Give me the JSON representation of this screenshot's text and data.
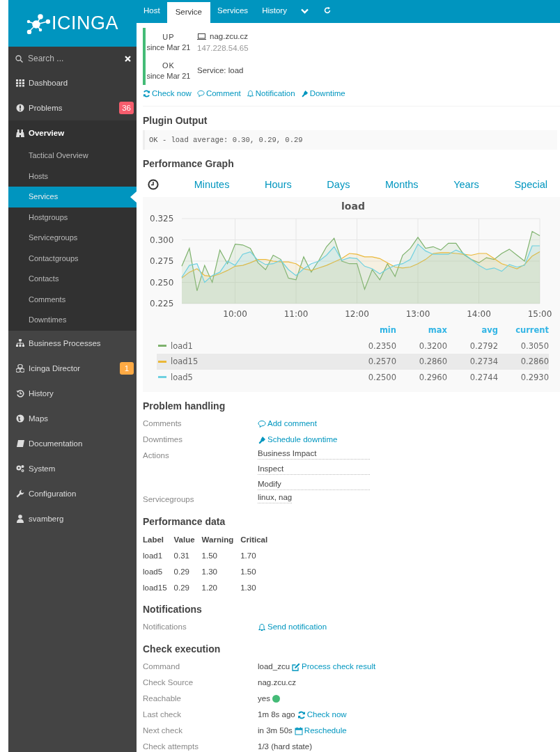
{
  "sidebar": {
    "logo": "ICINGA",
    "search": {
      "placeholder": "Search ..."
    },
    "items": [
      {
        "label": "Dashboard",
        "selected": false,
        "expanded": false
      },
      {
        "label": "Problems",
        "selected": false,
        "expanded": false,
        "badge": "36",
        "color": "#f65d6d"
      },
      {
        "label": "Overview",
        "selected": false,
        "expanded": true,
        "children": [
          {
            "label": "Tactical Overview",
            "selected": false
          },
          {
            "label": "Hosts",
            "selected": false
          },
          {
            "label": "Services",
            "selected": true
          },
          {
            "label": "Hostgroups",
            "selected": false
          },
          {
            "label": "Servicegroups",
            "selected": false
          },
          {
            "label": "Contactgroups",
            "selected": false
          },
          {
            "label": "Contacts",
            "selected": false
          },
          {
            "label": "Comments",
            "selected": false
          },
          {
            "label": "Downtimes",
            "selected": false
          }
        ]
      },
      {
        "label": "Business Processes",
        "selected": false,
        "expanded": false
      },
      {
        "label": "Icinga Director",
        "selected": false,
        "expanded": false,
        "badge": "1",
        "color": "#ffaa44"
      },
      {
        "label": "History",
        "selected": false,
        "expanded": false
      },
      {
        "label": "Maps",
        "selected": false,
        "expanded": false
      },
      {
        "label": "Documentation",
        "selected": false,
        "expanded": false
      },
      {
        "label": "System",
        "selected": false,
        "expanded": false
      },
      {
        "label": "Configuration",
        "selected": false,
        "expanded": false
      },
      {
        "label": "svamberg",
        "selected": false,
        "expanded": false
      }
    ]
  },
  "tabs": [
    {
      "label": "Host",
      "selected": false
    },
    {
      "label": "Service",
      "selected": true
    },
    {
      "label": "Services",
      "selected": false
    },
    {
      "label": "History",
      "selected": false
    }
  ],
  "header": {
    "host": {
      "state": "UP",
      "since": "since Mar 21",
      "name": "nag.zcu.cz",
      "address": "147.228.54.65",
      "color": "#44bb77"
    },
    "service": {
      "state": "OK",
      "since": "since Mar 21",
      "name": "Service: load",
      "color": "#44bb77"
    }
  },
  "actions": [
    {
      "kind": "recheck",
      "label": "Check now"
    },
    {
      "kind": "comment",
      "label": "Comment"
    },
    {
      "kind": "notification",
      "label": "Notification"
    },
    {
      "kind": "downtime",
      "label": "Downtime"
    }
  ],
  "plugin_output": {
    "title": "Plugin Output",
    "text": "OK - load average: 0.30, 0.29, 0.29"
  },
  "perf_graph": {
    "title": "Performance Graph",
    "ranges": [
      "Minutes",
      "Hours",
      "Days",
      "Months",
      "Years",
      "Special"
    ],
    "chart_data": {
      "type": "area",
      "title": "load",
      "x": [
        9.125,
        9.25,
        9.375,
        9.5,
        9.625,
        9.75,
        9.875,
        10,
        10.125,
        10.25,
        10.375,
        10.5,
        10.625,
        10.75,
        10.875,
        11,
        11.125,
        11.25,
        11.375,
        11.5,
        11.625,
        11.75,
        11.875,
        12,
        12.125,
        12.25,
        12.375,
        12.5,
        12.625,
        12.75,
        12.875,
        13,
        13.125,
        13.25,
        13.375,
        13.5,
        13.625,
        13.75,
        13.875,
        14,
        14.125,
        14.25,
        14.375,
        14.5,
        14.625,
        14.75,
        14.875,
        15
      ],
      "series": [
        {
          "name": "load1",
          "color": "#7eb26d",
          "values": [
            0.269,
            0.29,
            0.24,
            0.27,
            0.25,
            0.288,
            0.272,
            0.295,
            0.294,
            0.29,
            0.273,
            0.265,
            0.282,
            0.277,
            0.255,
            0.253,
            0.28,
            0.262,
            0.276,
            0.292,
            0.302,
            0.275,
            0.272,
            0.272,
            0.242,
            0.265,
            0.253,
            0.272,
            0.257,
            0.282,
            0.29,
            0.303,
            0.29,
            0.292,
            0.288,
            0.296,
            0.296,
            0.283,
            0.277,
            0.273,
            0.279,
            0.277,
            0.284,
            0.289,
            0.282,
            0.275,
            0.31,
            0.305
          ]
        },
        {
          "name": "load15",
          "color": "#eab839",
          "values": [
            0.255,
            0.262,
            0.266,
            0.258,
            0.257,
            0.26,
            0.264,
            0.269,
            0.27,
            0.273,
            0.277,
            0.277,
            0.275,
            0.274,
            0.274,
            0.272,
            0.266,
            0.264,
            0.267,
            0.27,
            0.274,
            0.278,
            0.284,
            0.283,
            0.28,
            0.28,
            0.278,
            0.273,
            0.268,
            0.267,
            0.268,
            0.272,
            0.277,
            0.284,
            0.285,
            0.285,
            0.284,
            0.283,
            0.282,
            0.284,
            0.284,
            0.278,
            0.272,
            0.269,
            0.266,
            0.271,
            0.281,
            0.286
          ]
        },
        {
          "name": "load5",
          "color": "#6ed0e0",
          "values": [
            0.256,
            0.27,
            0.272,
            0.25,
            0.258,
            0.262,
            0.275,
            0.27,
            0.283,
            0.286,
            0.276,
            0.271,
            0.272,
            0.276,
            0.265,
            0.258,
            0.266,
            0.272,
            0.275,
            0.282,
            0.292,
            0.276,
            0.279,
            0.278,
            0.269,
            0.266,
            0.26,
            0.266,
            0.27,
            0.272,
            0.277,
            0.295,
            0.287,
            0.283,
            0.283,
            0.283,
            0.288,
            0.284,
            0.277,
            0.27,
            0.265,
            0.267,
            0.263,
            0.271,
            0.268,
            0.27,
            0.293,
            0.293
          ]
        }
      ],
      "grid": true,
      "xlim": [
        9.125,
        15
      ],
      "ylim": [
        0.225,
        0.325
      ],
      "xticks": [
        {
          "value": 10,
          "label": "10:00"
        },
        {
          "value": 11,
          "label": "11:00"
        },
        {
          "value": 12,
          "label": "12:00"
        },
        {
          "value": 13,
          "label": "13:00"
        },
        {
          "value": 14,
          "label": "14:00"
        },
        {
          "value": 15,
          "label": "15:00"
        }
      ],
      "yticks": [
        {
          "value": 0.225,
          "label": "0.225"
        },
        {
          "value": 0.25,
          "label": "0.250"
        },
        {
          "value": 0.275,
          "label": "0.275"
        },
        {
          "value": 0.3,
          "label": "0.300"
        },
        {
          "value": 0.325,
          "label": "0.325"
        }
      ]
    },
    "legend": {
      "columns": [
        "min",
        "max",
        "avg",
        "current"
      ],
      "rows": [
        {
          "selected": false,
          "values": [
            "0.2350",
            "0.3200",
            "0.2792",
            "0.3050"
          ]
        },
        {
          "selected": true,
          "values": [
            "0.2570",
            "0.2860",
            "0.2734",
            "0.2860"
          ]
        },
        {
          "selected": false,
          "values": [
            "0.2500",
            "0.2960",
            "0.2744",
            "0.2930"
          ]
        }
      ]
    }
  },
  "problem_handling": {
    "title": "Problem handling",
    "rows": [
      {
        "label": "Comments",
        "values": [
          {
            "kind": "comment",
            "text": "Add comment"
          }
        ]
      },
      {
        "label": "Downtimes",
        "values": [
          {
            "kind": "downtime",
            "text": "Schedule downtime"
          }
        ]
      },
      {
        "label": "Actions",
        "values": [
          {
            "kind": "action",
            "text": "Business Impact"
          },
          {
            "kind": "action",
            "text": "Inspect"
          },
          {
            "kind": "action",
            "text": "Modify"
          }
        ]
      },
      {
        "label": "Servicegroups",
        "values": [
          {
            "kind": "action",
            "text": "linux, nag"
          }
        ]
      }
    ]
  },
  "performance_data": {
    "title": "Performance data",
    "columns": [
      "Label",
      "Value",
      "Warning",
      "Critical"
    ],
    "rows": [
      [
        "load1",
        "0.31",
        "1.50",
        "1.70"
      ],
      [
        "load5",
        "0.29",
        "1.30",
        "1.50"
      ],
      [
        "load15",
        "0.29",
        "1.20",
        "1.30"
      ]
    ]
  },
  "notifications": {
    "title": "Notifications",
    "rows": [
      {
        "label": "Notifications",
        "values": [
          {
            "kind": "notification",
            "text": "Send notification"
          }
        ]
      }
    ]
  },
  "check_execution": {
    "title": "Check execution",
    "rows": [
      {
        "label": "Command",
        "values": [
          {
            "kind": "text",
            "text": "load_zcu"
          },
          {
            "kind": "process",
            "text": "Process check result"
          }
        ]
      },
      {
        "label": "Check Source",
        "values": [
          {
            "kind": "text",
            "text": "nag.zcu.cz"
          }
        ]
      },
      {
        "label": "Reachable",
        "values": [
          {
            "kind": "text",
            "text": "yes"
          },
          {
            "kind": "dot",
            "color": "#44bb77"
          }
        ]
      },
      {
        "label": "Last check",
        "values": [
          {
            "kind": "text",
            "text": "1m 8s ago"
          },
          {
            "kind": "recheck",
            "text": "Check now"
          }
        ]
      },
      {
        "label": "Next check",
        "values": [
          {
            "kind": "text",
            "text": "in 3m 50s"
          },
          {
            "kind": "reschedule",
            "text": "Reschedule"
          }
        ]
      },
      {
        "label": "Check attempts",
        "values": [
          {
            "kind": "text",
            "text": "1/3 (hard state)"
          }
        ]
      }
    ]
  }
}
